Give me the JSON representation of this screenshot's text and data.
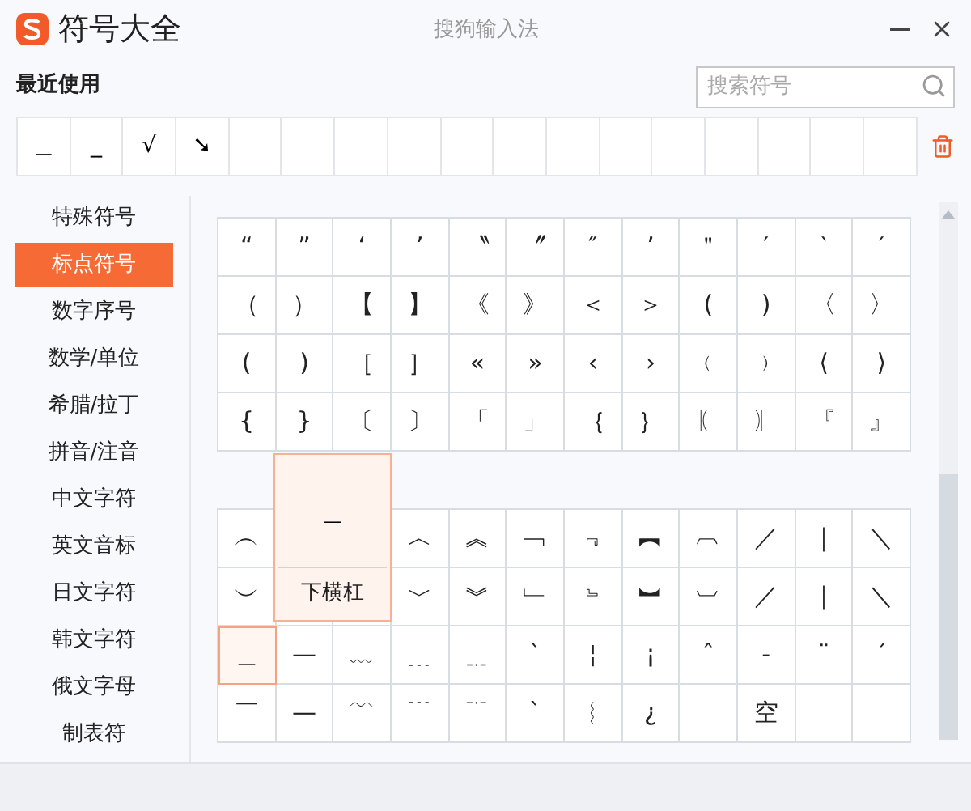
{
  "window": {
    "title": "符号大全",
    "app_name": "搜狗输入法"
  },
  "recent": {
    "label": "最近使用",
    "slots": [
      {
        "symbol": "＿"
      },
      {
        "symbol": "_"
      },
      {
        "symbol": "√"
      },
      {
        "symbol": "➘"
      }
    ]
  },
  "search": {
    "placeholder": "搜索符号"
  },
  "sidebar": {
    "items": [
      {
        "label": "特殊符号",
        "selected": false
      },
      {
        "label": "标点符号",
        "selected": true
      },
      {
        "label": "数字序号",
        "selected": false
      },
      {
        "label": "数学/单位",
        "selected": false
      },
      {
        "label": "希腊/拉丁",
        "selected": false
      },
      {
        "label": "拼音/注音",
        "selected": false
      },
      {
        "label": "中文字符",
        "selected": false
      },
      {
        "label": "英文音标",
        "selected": false
      },
      {
        "label": "日文字符",
        "selected": false
      },
      {
        "label": "韩文字符",
        "selected": false
      },
      {
        "label": "俄文字母",
        "selected": false
      },
      {
        "label": "制表符",
        "selected": false
      }
    ]
  },
  "grids": [
    {
      "rows": [
        [
          {
            "symbol": "“",
            "selected": false
          },
          {
            "symbol": "”",
            "selected": false
          },
          {
            "symbol": "‘",
            "selected": false
          },
          {
            "symbol": "’",
            "selected": false
          },
          {
            "symbol": "〝",
            "selected": false
          },
          {
            "symbol": "〞",
            "selected": false
          },
          {
            "symbol": "″",
            "selected": false
          },
          {
            "symbol": "’",
            "selected": false
          },
          {
            "symbol": "＂",
            "selected": false
          },
          {
            "symbol": "′",
            "selected": false
          },
          {
            "symbol": "‵",
            "selected": false
          },
          {
            "symbol": "′",
            "selected": false
          }
        ],
        [
          {
            "symbol": "（",
            "selected": false
          },
          {
            "symbol": "）",
            "selected": false
          },
          {
            "symbol": "【",
            "selected": false
          },
          {
            "symbol": "】",
            "selected": false
          },
          {
            "symbol": "《",
            "selected": false
          },
          {
            "symbol": "》",
            "selected": false
          },
          {
            "symbol": "＜",
            "selected": false
          },
          {
            "symbol": "＞",
            "selected": false
          },
          {
            "symbol": "(",
            "selected": false
          },
          {
            "symbol": ")",
            "selected": false
          },
          {
            "symbol": "〈",
            "selected": false
          },
          {
            "symbol": "〉",
            "selected": false
          }
        ],
        [
          {
            "symbol": "(",
            "selected": false
          },
          {
            "symbol": ")",
            "selected": false
          },
          {
            "symbol": "［",
            "selected": false
          },
          {
            "symbol": "］",
            "selected": false
          },
          {
            "symbol": "«",
            "selected": false
          },
          {
            "symbol": "»",
            "selected": false
          },
          {
            "symbol": "‹",
            "selected": false
          },
          {
            "symbol": "›",
            "selected": false
          },
          {
            "symbol": "﹙",
            "selected": false
          },
          {
            "symbol": "﹚",
            "selected": false
          },
          {
            "symbol": "⟨",
            "selected": false
          },
          {
            "symbol": "⟩",
            "selected": false
          }
        ],
        [
          {
            "symbol": "{",
            "selected": false
          },
          {
            "symbol": "}",
            "selected": false
          },
          {
            "symbol": "〔",
            "selected": false
          },
          {
            "symbol": "〕",
            "selected": false
          },
          {
            "symbol": "「",
            "selected": false
          },
          {
            "symbol": "」",
            "selected": false
          },
          {
            "symbol": "｛",
            "selected": false
          },
          {
            "symbol": "｝",
            "selected": false
          },
          {
            "symbol": "〖",
            "selected": false
          },
          {
            "symbol": "〗",
            "selected": false
          },
          {
            "symbol": "『",
            "selected": false
          },
          {
            "symbol": "』",
            "selected": false
          }
        ]
      ]
    },
    {
      "rows": [
        [
          {
            "symbol": "︵",
            "selected": false
          },
          {},
          {},
          {
            "symbol": "︿",
            "selected": false
          },
          {
            "symbol": "︽",
            "selected": false
          },
          {
            "symbol": "﹁",
            "selected": false
          },
          {
            "symbol": "﹃",
            "selected": false
          },
          {
            "symbol": "︻",
            "selected": false
          },
          {
            "symbol": "︹",
            "selected": false
          },
          {
            "symbol": "／",
            "selected": false
          },
          {
            "symbol": "｜",
            "selected": false
          },
          {
            "symbol": "＼",
            "selected": false
          }
        ],
        [
          {
            "symbol": "︶",
            "selected": false
          },
          {},
          {},
          {
            "symbol": "﹀",
            "selected": false
          },
          {
            "symbol": "︾",
            "selected": false
          },
          {
            "symbol": "﹂",
            "selected": false
          },
          {
            "symbol": "﹄",
            "selected": false
          },
          {
            "symbol": "︼",
            "selected": false
          },
          {
            "symbol": "︺",
            "selected": false
          },
          {
            "symbol": "／",
            "selected": false
          },
          {
            "symbol": "｜",
            "selected": false
          },
          {
            "symbol": "＼",
            "selected": false
          }
        ],
        [
          {
            "symbol": "＿",
            "selected": true
          },
          {
            "symbol": "—",
            "selected": false
          },
          {
            "symbol": "﹏",
            "selected": false
          },
          {
            "symbol": "﹍",
            "selected": false
          },
          {
            "symbol": "﹎",
            "selected": false
          },
          {
            "symbol": "ˋ",
            "selected": false
          },
          {
            "symbol": "¦",
            "selected": false
          },
          {
            "symbol": "¡",
            "selected": false
          },
          {
            "symbol": "ˆ",
            "selected": false
          },
          {
            "symbol": "-",
            "selected": false
          },
          {
            "symbol": "¨",
            "selected": false
          },
          {
            "symbol": "ˊ",
            "selected": false
          }
        ],
        [
          {
            "symbol": "￣",
            "selected": false
          },
          {
            "symbol": "—",
            "selected": false
          },
          {
            "symbol": "﹋",
            "selected": false
          },
          {
            "symbol": "﹉",
            "selected": false
          },
          {
            "symbol": "﹊",
            "selected": false
          },
          {
            "symbol": "ˋ",
            "selected": false
          },
          {
            "symbol": "︴",
            "selected": false
          },
          {
            "symbol": "¿",
            "selected": false
          },
          {
            "selected": false
          },
          {
            "symbol": "空",
            "selected": false
          },
          {
            "selected": false
          },
          {
            "selected": false
          }
        ]
      ]
    }
  ],
  "tooltip": {
    "symbol": "＿",
    "name": "下横杠"
  }
}
